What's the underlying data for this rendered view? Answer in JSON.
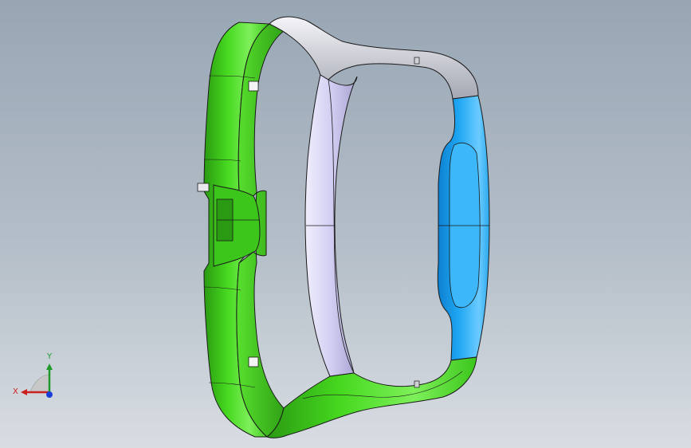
{
  "viewport": {
    "background_top": "#98a6b4",
    "background_bottom": "#d8dde2"
  },
  "model": {
    "colors": {
      "green": "#3fd11e",
      "green_dark": "#2a9a12",
      "green_light": "#7ef05a",
      "lavender": "#ccc8ee",
      "lavender_dark": "#9e99c8",
      "white": "#e8e8ee",
      "gray": "#a8abb4",
      "blue": "#1ea6f2",
      "blue_light": "#6ccbff",
      "edge": "#1a1a1a"
    }
  },
  "triad": {
    "x_label": "X",
    "y_label": "Y",
    "x_color": "#cc2020",
    "y_color": "#1f9a2a",
    "z_color": "#1a3fd8",
    "plane_color": "#c8c8c8"
  }
}
